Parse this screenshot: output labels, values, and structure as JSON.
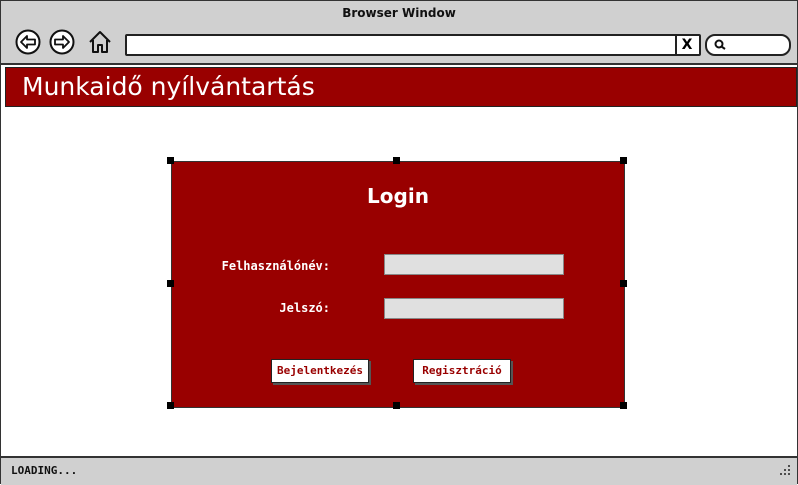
{
  "window": {
    "title": "Browser Window"
  },
  "toolbar": {
    "back_icon": "back-arrow-icon",
    "forward_icon": "forward-arrow-icon",
    "home_icon": "home-icon",
    "url_value": "",
    "clear_label": "X",
    "search_icon": "search-icon"
  },
  "header": {
    "title": "Munkaidő nyílvántartás",
    "color": "#990000"
  },
  "login": {
    "title": "Login",
    "username_label": "Felhasználónév:",
    "password_label": "Jelszó:",
    "username_value": "",
    "password_value": "",
    "login_button": "Bejelentkezés",
    "register_button": "Regisztráció"
  },
  "status": {
    "text": "LOADING..."
  }
}
